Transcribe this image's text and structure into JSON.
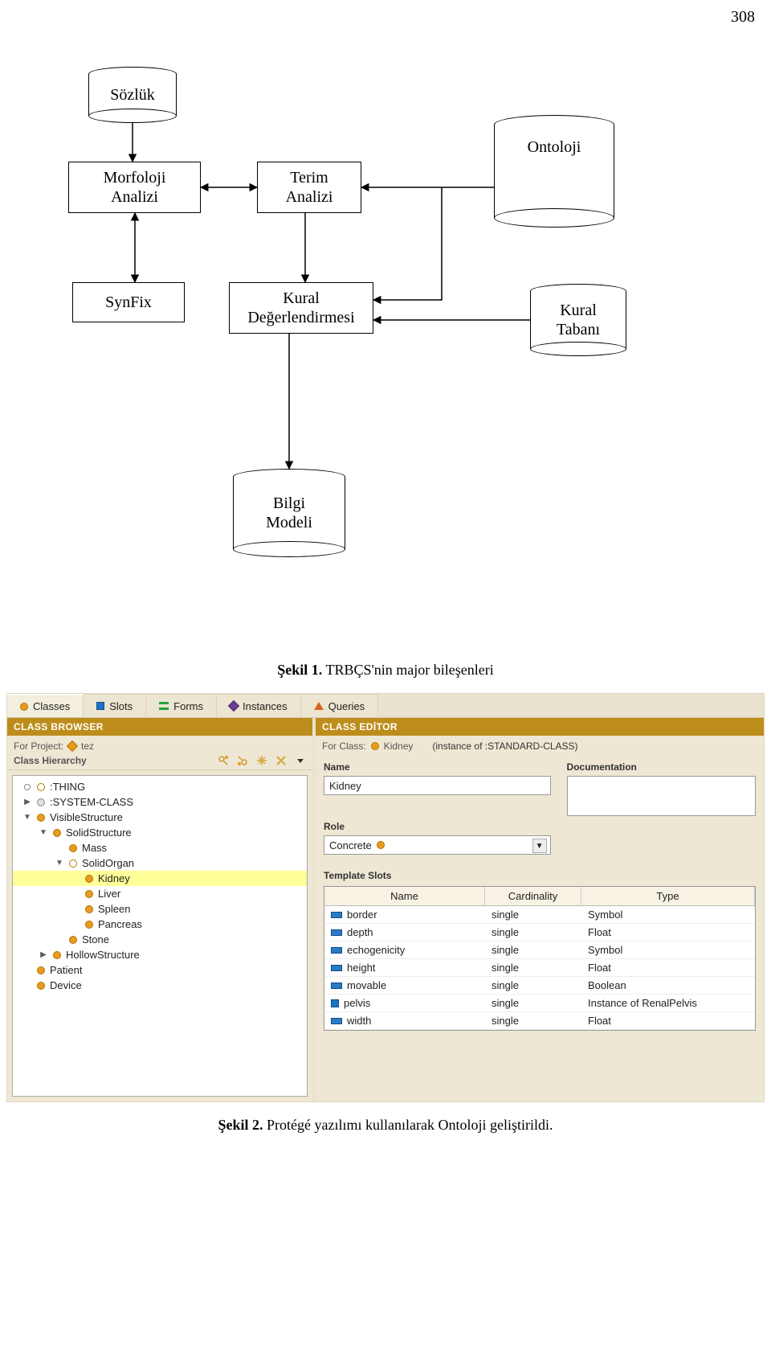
{
  "page_number": "308",
  "diagram": {
    "sozluk": "Sözlük",
    "morfoloji": "Morfoloji\nAnalizi",
    "terim": "Terim\nAnalizi",
    "ontoloji": "Ontoloji",
    "synfix": "SynFix",
    "kural_degerlendirmesi": "Kural\nDeğerlendirmesi",
    "kural_tabani": "Kural\nTabanı",
    "bilgi_modeli": "Bilgi\nModeli"
  },
  "caption1_bold": "Şekil 1.",
  "caption1_rest": " TRBÇS'nin major bileşenleri",
  "protege": {
    "tabs": [
      {
        "icon": "dot-orange",
        "label": "Classes"
      },
      {
        "icon": "square-blue",
        "label": "Slots"
      },
      {
        "icon": "bars",
        "label": "Forms"
      },
      {
        "icon": "diamond",
        "label": "Instances"
      },
      {
        "icon": "tri",
        "label": "Queries"
      }
    ],
    "left_header": "CLASS BROWSER",
    "for_project_label": "For Project:",
    "project_name": "tez",
    "hierarchy_label": "Class Hierarchy",
    "tree": [
      {
        "indent": 0,
        "tw": "open-circle",
        "icon": "circ-open",
        "label": ":THING"
      },
      {
        "indent": 0,
        "tw": "▶",
        "icon": "dot-gray",
        "label": ":SYSTEM-CLASS"
      },
      {
        "indent": 0,
        "tw": "▼",
        "icon": "dot-orange",
        "label": "VisibleStructure"
      },
      {
        "indent": 1,
        "tw": "▼",
        "icon": "dot-orange",
        "label": "SolidStructure"
      },
      {
        "indent": 2,
        "tw": "",
        "icon": "dot-orange",
        "label": "Mass"
      },
      {
        "indent": 2,
        "tw": "▼",
        "icon": "circ-open",
        "label": "SolidOrgan"
      },
      {
        "indent": 3,
        "tw": "",
        "icon": "dot-orange",
        "label": "Kidney",
        "selected": true
      },
      {
        "indent": 3,
        "tw": "",
        "icon": "dot-orange",
        "label": "Liver"
      },
      {
        "indent": 3,
        "tw": "",
        "icon": "dot-orange",
        "label": "Spleen"
      },
      {
        "indent": 3,
        "tw": "",
        "icon": "dot-orange",
        "label": "Pancreas"
      },
      {
        "indent": 2,
        "tw": "",
        "icon": "dot-orange",
        "label": "Stone"
      },
      {
        "indent": 1,
        "tw": "▶",
        "icon": "dot-orange",
        "label": "HollowStructure"
      },
      {
        "indent": 0,
        "tw": "",
        "icon": "dot-orange",
        "label": "Patient"
      },
      {
        "indent": 0,
        "tw": "",
        "icon": "dot-orange",
        "label": "Device"
      }
    ],
    "right_header": "CLASS EDİTOR",
    "for_class_label": "For Class:",
    "class_name": "Kidney",
    "instance_of": "(instance of :STANDARD-CLASS)",
    "name_label": "Name",
    "name_value": "Kidney",
    "doc_label": "Documentation",
    "role_label": "Role",
    "role_value": "Concrete",
    "tslots_label": "Template Slots",
    "cols": {
      "name": "Name",
      "card": "Cardinality",
      "type": "Type"
    },
    "slots": [
      {
        "name": "border",
        "card": "single",
        "type": "Symbol"
      },
      {
        "name": "depth",
        "card": "single",
        "type": "Float"
      },
      {
        "name": "echogenicity",
        "card": "single",
        "type": "Symbol"
      },
      {
        "name": "height",
        "card": "single",
        "type": "Float"
      },
      {
        "name": "movable",
        "card": "single",
        "type": "Boolean"
      },
      {
        "name": "pelvis",
        "card": "single",
        "type": "Instance of RenalPelvis",
        "square": true
      },
      {
        "name": "width",
        "card": "single",
        "type": "Float"
      }
    ]
  },
  "caption2_bold": "Şekil 2.",
  "caption2_rest": " Protégé yazılımı kullanılarak  Ontoloji geliştirildi."
}
